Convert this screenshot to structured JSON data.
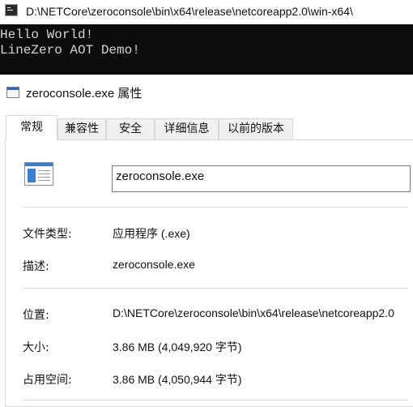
{
  "console": {
    "title": "D:\\NETCore\\zeroconsole\\bin\\x64\\release\\netcoreapp2.0\\win-x64\\",
    "lines": [
      "Hello World!",
      "LineZero AOT Demo!"
    ]
  },
  "dialog": {
    "title": "zeroconsole.exe 属性",
    "tabs": [
      {
        "label": "常规"
      },
      {
        "label": "兼容性"
      },
      {
        "label": "安全"
      },
      {
        "label": "详细信息"
      },
      {
        "label": "以前的版本"
      }
    ],
    "active_tab": "常规",
    "file_name": "zeroconsole.exe",
    "properties": {
      "type": {
        "label": "文件类型:",
        "value": "应用程序 (.exe)"
      },
      "description": {
        "label": "描述:",
        "value": "zeroconsole.exe"
      },
      "location": {
        "label": "位置:",
        "value": "D:\\NETCore\\zeroconsole\\bin\\x64\\release\\netcoreapp2.0"
      },
      "size": {
        "label": "大小:",
        "value": "3.86 MB (4,049,920 字节)"
      },
      "size_on_disk": {
        "label": "占用空间:",
        "value": "3.86 MB (4,050,944 字节)"
      }
    }
  }
}
